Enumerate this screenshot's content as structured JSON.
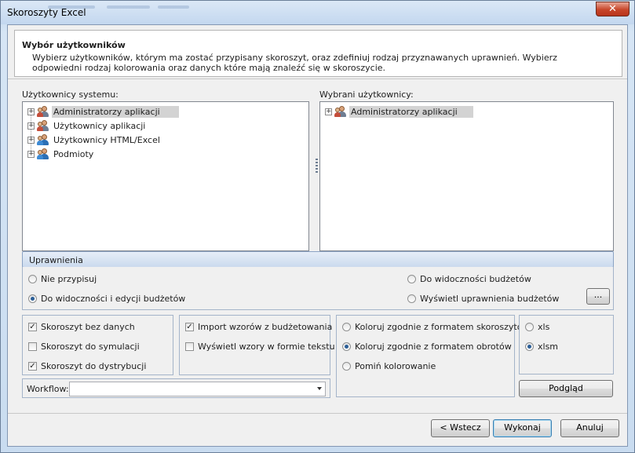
{
  "window": {
    "title": "Skoroszyty Excel",
    "close": "✕"
  },
  "header": {
    "title": "Wybór użytkowników",
    "description": "Wybierz użytkowników, którym ma zostać przypisany skoroszyt, oraz zdefiniuj rodzaj przyznawanych uprawnień. Wybierz odpowiedni rodzaj kolorowania oraz danych które mają znaleźć się w skoroszycie."
  },
  "system_users": {
    "label": "Użytkownicy systemu:",
    "items": [
      {
        "label": "Administratorzy aplikacji",
        "selected": true,
        "expander": "+"
      },
      {
        "label": "Użytkownicy aplikacji",
        "selected": false,
        "expander": "+"
      },
      {
        "label": "Użytkownicy HTML/Excel",
        "selected": false,
        "expander": "+"
      },
      {
        "label": "Podmioty",
        "selected": false,
        "expander": "+"
      }
    ]
  },
  "selected_users": {
    "label": "Wybrani użytkownicy:",
    "items": [
      {
        "label": "Administratorzy aplikacji",
        "selected": true,
        "expander": "+"
      }
    ]
  },
  "permissions": {
    "header": "Uprawnienia",
    "options": [
      {
        "label": "Nie przypisuj",
        "checked": false
      },
      {
        "label": "Do widoczności i edycji budżetów",
        "checked": true
      },
      {
        "label": "Do widoczności budżetów",
        "checked": false
      },
      {
        "label": "Wyświetl uprawnienia budżetów",
        "checked": false
      }
    ],
    "ellipsis": "..."
  },
  "workbook_type": [
    {
      "label": "Skoroszyt bez danych",
      "checked": true
    },
    {
      "label": "Skoroszyt do symulacji",
      "checked": false
    },
    {
      "label": "Skoroszyt do dystrybucji",
      "checked": true
    }
  ],
  "import_options": [
    {
      "label": "Import wzorów z budżetowania",
      "checked": true
    },
    {
      "label": "Wyświetl wzory w formie tekstu",
      "checked": false
    }
  ],
  "coloring": [
    {
      "label": "Koloruj zgodnie z formatem skoroszytów",
      "checked": false
    },
    {
      "label": "Koloruj zgodnie z formatem obrotów",
      "checked": true
    },
    {
      "label": "Pomiń kolorowanie",
      "checked": false
    }
  ],
  "format": [
    {
      "label": "xls",
      "checked": false
    },
    {
      "label": "xlsm",
      "checked": true
    }
  ],
  "workflow": {
    "label": "Workflow:",
    "value": ""
  },
  "buttons": {
    "preview": "Podgląd",
    "back": "< Wstecz",
    "execute": "Wykonaj",
    "cancel": "Anuluj"
  },
  "check_mark": "✓",
  "colors": {
    "accent": "#2a5d96",
    "group_header": "#cbdaee",
    "selection": "#d3d3d3"
  }
}
